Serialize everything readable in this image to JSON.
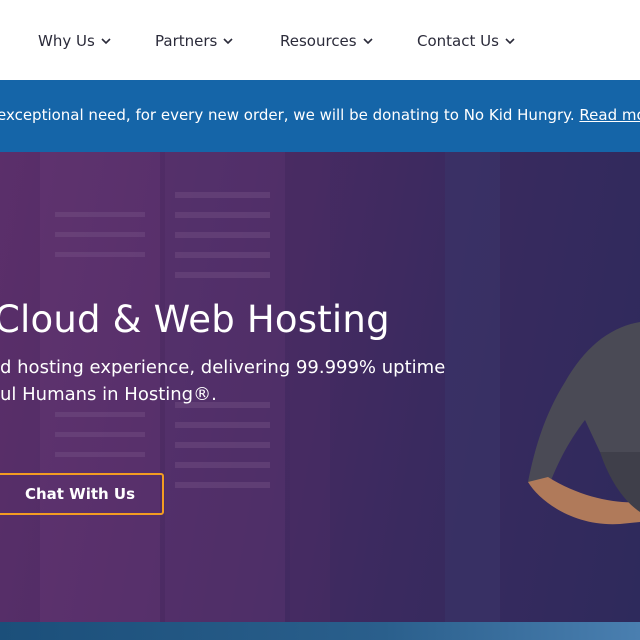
{
  "nav": {
    "items": [
      {
        "label": "Why Us"
      },
      {
        "label": "Partners"
      },
      {
        "label": "Resources"
      },
      {
        "label": "Contact Us"
      }
    ]
  },
  "banner": {
    "text": "exceptional need, for every new order, we will be donating to No Kid Hungry.",
    "link": "Read more a"
  },
  "hero": {
    "title": "Cloud & Web Hosting",
    "subtitle_line1": "d hosting experience, delivering 99.999% uptime",
    "subtitle_line2": "ul Humans in Hosting®.",
    "cta": "Chat With Us"
  },
  "colors": {
    "banner": "#1565a8",
    "cta_border": "#f39c22",
    "hero_start": "#5b2f6a",
    "hero_end": "#2e2a5c"
  }
}
